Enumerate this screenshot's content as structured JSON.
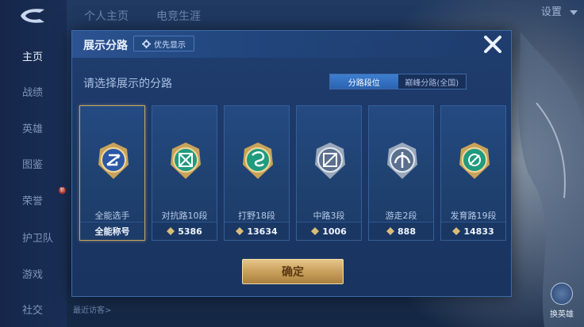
{
  "background": {
    "top_tabs": [
      "个人主页",
      "电竞生涯"
    ],
    "settings_label": "设置",
    "sidebar": [
      {
        "label": "主页",
        "active": true
      },
      {
        "label": "战绩",
        "active": false
      },
      {
        "label": "英雄",
        "active": false
      },
      {
        "label": "图鉴",
        "active": false
      },
      {
        "label": "荣誉",
        "active": false
      },
      {
        "label": "护卫队",
        "active": false
      },
      {
        "label": "游戏",
        "active": false
      },
      {
        "label": "社交",
        "active": false
      }
    ],
    "recent_visitors": "最近访客>",
    "switch_hero_label": "换英雄"
  },
  "dialog": {
    "title": "展示分路",
    "priority_label": "优先显示",
    "subtitle": "请选择展示的分路",
    "toggle": {
      "active": "分路段位",
      "inactive": "巅峰分路(全国)"
    },
    "confirm_label": "确定",
    "colors": {
      "gold": "#c7a763",
      "teal_emblem": "#2fbf9f",
      "accent_blue": "#3e7fd0"
    }
  },
  "cards": [
    {
      "role": "全能选手",
      "value": "全能称号",
      "emblem": "all-round-emblem",
      "selected": true,
      "icon": null
    },
    {
      "role": "对抗路10段",
      "value": "5386",
      "emblem": "clash-lane-emblem",
      "selected": false,
      "icon": "coin-icon"
    },
    {
      "role": "打野18段",
      "value": "13634",
      "emblem": "jungle-emblem",
      "selected": false,
      "icon": "coin-icon"
    },
    {
      "role": "中路3段",
      "value": "1006",
      "emblem": "mid-lane-emblem",
      "selected": false,
      "icon": "coin-icon"
    },
    {
      "role": "游走2段",
      "value": "888",
      "emblem": "roam-emblem",
      "selected": false,
      "icon": "coin-icon"
    },
    {
      "role": "发育路19段",
      "value": "14833",
      "emblem": "farm-lane-emblem",
      "selected": false,
      "icon": "coin-icon"
    }
  ]
}
